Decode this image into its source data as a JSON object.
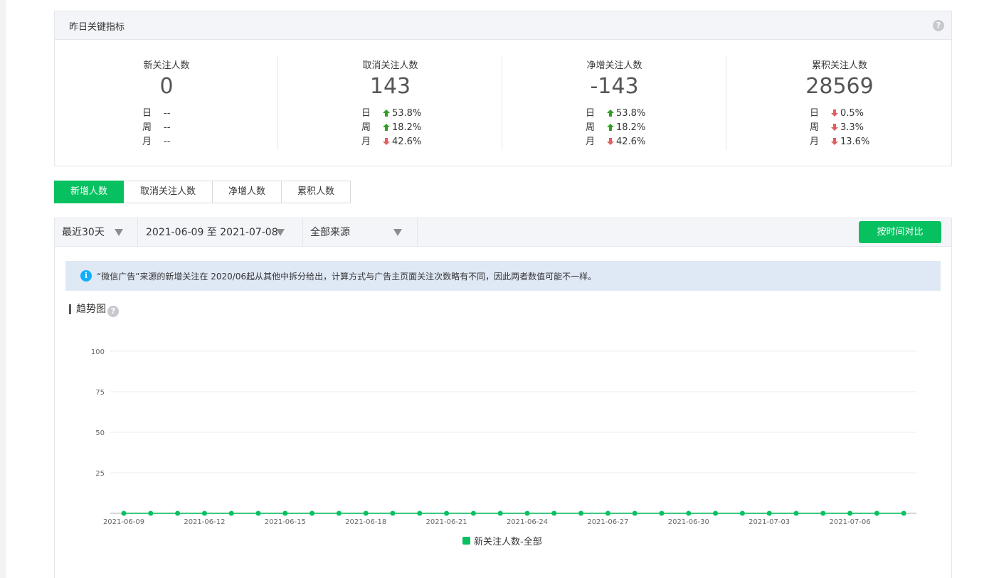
{
  "kpi": {
    "title": "昨日关键指标",
    "help": "?",
    "cards": [
      {
        "label": "新关注人数",
        "value": "0",
        "rows": [
          {
            "label": "日",
            "dir": "none",
            "value": "--"
          },
          {
            "label": "周",
            "dir": "none",
            "value": "--"
          },
          {
            "label": "月",
            "dir": "none",
            "value": "--"
          }
        ]
      },
      {
        "label": "取消关注人数",
        "value": "143",
        "rows": [
          {
            "label": "日",
            "dir": "up",
            "value": "53.8%"
          },
          {
            "label": "周",
            "dir": "up",
            "value": "18.2%"
          },
          {
            "label": "月",
            "dir": "down",
            "value": "42.6%"
          }
        ]
      },
      {
        "label": "净增关注人数",
        "value": "-143",
        "rows": [
          {
            "label": "日",
            "dir": "up",
            "value": "53.8%"
          },
          {
            "label": "周",
            "dir": "up",
            "value": "18.2%"
          },
          {
            "label": "月",
            "dir": "down",
            "value": "42.6%"
          }
        ]
      },
      {
        "label": "累积关注人数",
        "value": "28569",
        "rows": [
          {
            "label": "日",
            "dir": "down",
            "value": "0.5%"
          },
          {
            "label": "周",
            "dir": "down",
            "value": "3.3%"
          },
          {
            "label": "月",
            "dir": "down",
            "value": "13.6%"
          }
        ]
      }
    ]
  },
  "tabs": [
    {
      "label": "新增人数",
      "active": true
    },
    {
      "label": "取消关注人数",
      "active": false
    },
    {
      "label": "净增人数",
      "active": false
    },
    {
      "label": "累积人数",
      "active": false
    }
  ],
  "toolbar": {
    "range": "最近30天",
    "dates": "2021-06-09 至 2021-07-08",
    "source": "全部来源",
    "compare": "按时间对比"
  },
  "info": {
    "icon": "info-icon",
    "text": "“微信广告”来源的新增关注在 2020/06起从其他中拆分给出，计算方式与广告主页面关注次数略有不同，因此两者数值可能不一样。"
  },
  "trend": {
    "title": "趋势图",
    "help": "?"
  },
  "colors": {
    "accent": "#07c160",
    "up": "#2ea121",
    "down": "#e15f63"
  },
  "chart_data": {
    "type": "line",
    "ylim": [
      0,
      100
    ],
    "yticks": [
      25,
      50,
      75,
      100
    ],
    "x": [
      "2021-06-09",
      "2021-06-10",
      "2021-06-11",
      "2021-06-12",
      "2021-06-13",
      "2021-06-14",
      "2021-06-15",
      "2021-06-16",
      "2021-06-17",
      "2021-06-18",
      "2021-06-19",
      "2021-06-20",
      "2021-06-21",
      "2021-06-22",
      "2021-06-23",
      "2021-06-24",
      "2021-06-25",
      "2021-06-26",
      "2021-06-27",
      "2021-06-28",
      "2021-06-29",
      "2021-06-30",
      "2021-07-01",
      "2021-07-02",
      "2021-07-03",
      "2021-07-04",
      "2021-07-05",
      "2021-07-06",
      "2021-07-07",
      "2021-07-08"
    ],
    "xtick_labels": [
      "2021-06-09",
      "2021-06-12",
      "2021-06-15",
      "2021-06-18",
      "2021-06-21",
      "2021-06-24",
      "2021-06-27",
      "2021-06-30",
      "2021-07-03",
      "2021-07-06"
    ],
    "series": [
      {
        "name": "新关注人数-全部",
        "color": "#07c160",
        "values": [
          0,
          0,
          0,
          0,
          0,
          0,
          0,
          0,
          0,
          0,
          0,
          0,
          0,
          0,
          0,
          0,
          0,
          0,
          0,
          0,
          0,
          0,
          0,
          0,
          0,
          0,
          0,
          0,
          0,
          0
        ]
      }
    ],
    "legend": "bottom-center",
    "grid": true
  }
}
